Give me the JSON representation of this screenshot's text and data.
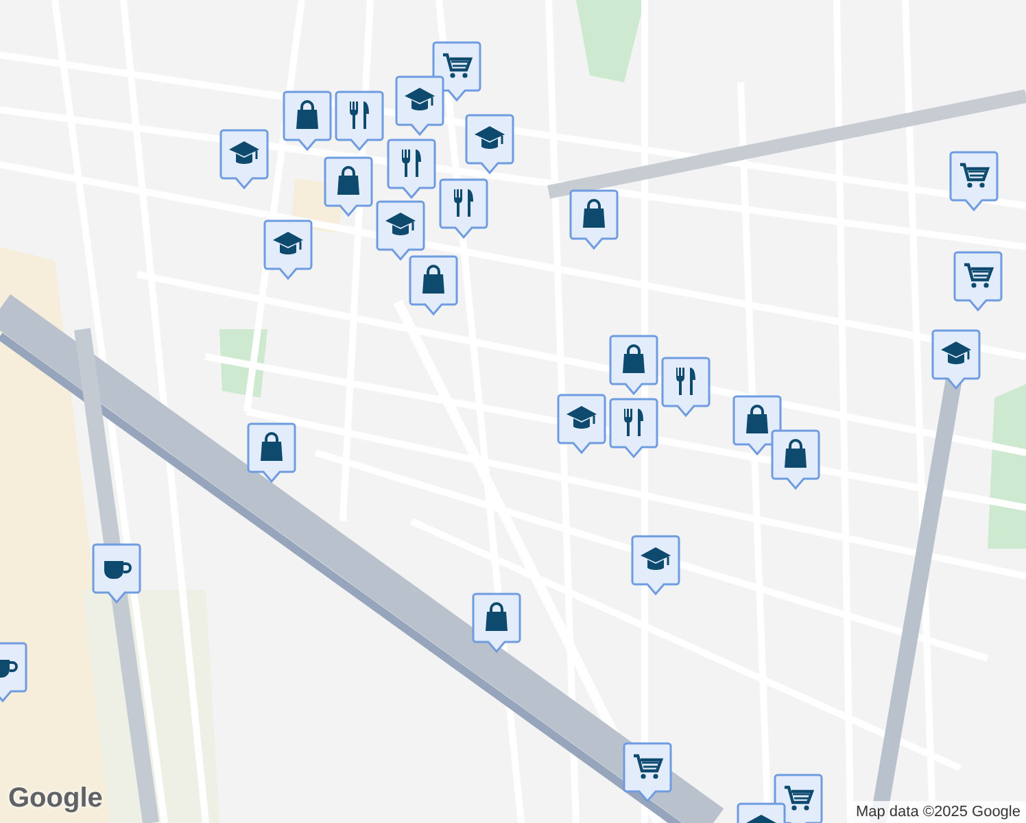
{
  "map": {
    "pins": [
      {
        "kind": "cart"
      },
      {
        "kind": "cap"
      },
      {
        "kind": "cap"
      },
      {
        "kind": "cap"
      },
      {
        "kind": "bag"
      },
      {
        "kind": "bag"
      },
      {
        "kind": "restaurant"
      },
      {
        "kind": "restaurant"
      },
      {
        "kind": "restaurant"
      },
      {
        "kind": "cap"
      },
      {
        "kind": "cap"
      },
      {
        "kind": "bag"
      },
      {
        "kind": "bag"
      },
      {
        "kind": "cart"
      },
      {
        "kind": "cart"
      },
      {
        "kind": "cap"
      },
      {
        "kind": "cap"
      },
      {
        "kind": "bag"
      },
      {
        "kind": "restaurant"
      },
      {
        "kind": "restaurant"
      },
      {
        "kind": "bag"
      },
      {
        "kind": "bag"
      },
      {
        "kind": "bag"
      },
      {
        "kind": "cap"
      },
      {
        "kind": "bag"
      },
      {
        "kind": "coffee"
      },
      {
        "kind": "coffee"
      },
      {
        "kind": "cart"
      },
      {
        "kind": "cart"
      },
      {
        "kind": "cap"
      }
    ]
  },
  "logo": "Google",
  "attribution": "Map data ©2025 Google"
}
